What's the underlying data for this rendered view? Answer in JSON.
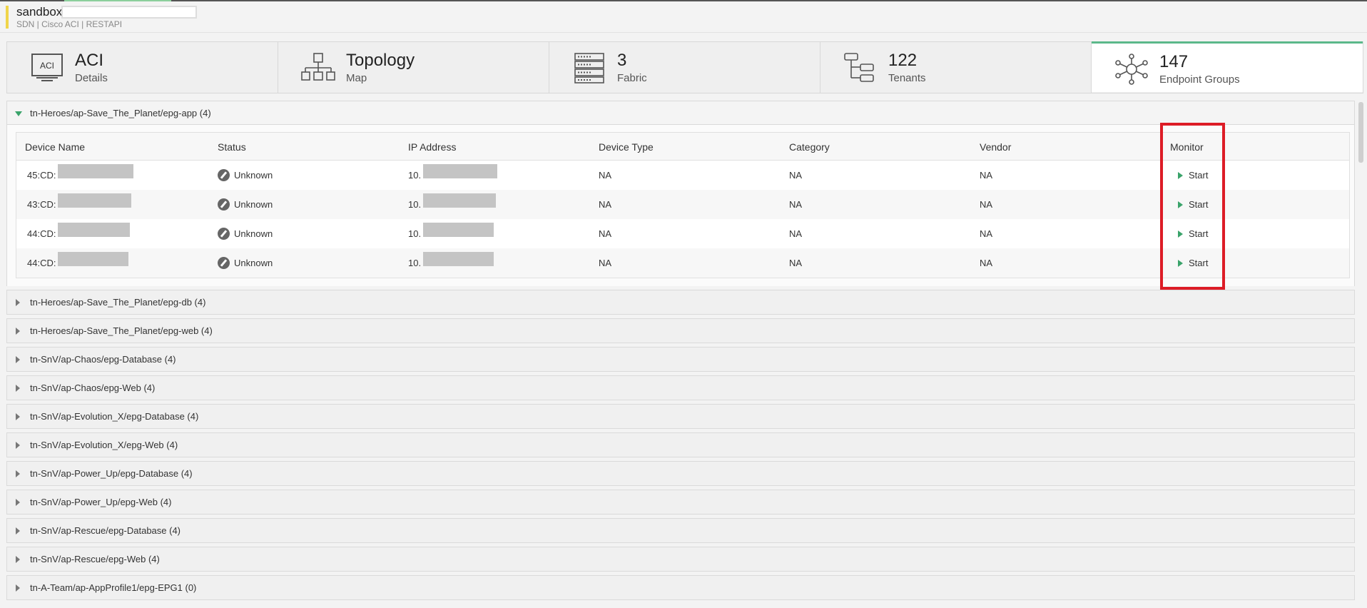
{
  "header": {
    "title": "sandbox",
    "subtitle": "SDN | Cisco ACI | RESTAPI"
  },
  "tiles": [
    {
      "main": "ACI",
      "sub": "Details",
      "icon": "aci-monitor-icon"
    },
    {
      "main": "Topology",
      "sub": "Map",
      "icon": "topology-icon"
    },
    {
      "main": "3",
      "sub": "Fabric",
      "icon": "server-rack-icon"
    },
    {
      "main": "122",
      "sub": "Tenants",
      "icon": "tree-icon"
    },
    {
      "main": "147",
      "sub": "Endpoint Groups",
      "icon": "network-hub-icon"
    }
  ],
  "expanded_group": {
    "label": "tn-Heroes/ap-Save_The_Planet/epg-app (4)",
    "columns": [
      "Device Name",
      "Status",
      "IP Address",
      "Device Type",
      "Category",
      "Vendor",
      "Monitor"
    ],
    "rows": [
      {
        "device": "45:CD:",
        "status": "Unknown",
        "ip": "10.",
        "type": "NA",
        "category": "NA",
        "vendor": "NA",
        "monitor": "Start"
      },
      {
        "device": "43:CD:",
        "status": "Unknown",
        "ip": "10.",
        "type": "NA",
        "category": "NA",
        "vendor": "NA",
        "monitor": "Start"
      },
      {
        "device": "44:CD:",
        "status": "Unknown",
        "ip": "10.",
        "type": "NA",
        "category": "NA",
        "vendor": "NA",
        "monitor": "Start"
      },
      {
        "device": "44:CD:",
        "status": "Unknown",
        "ip": "10.",
        "type": "NA",
        "category": "NA",
        "vendor": "NA",
        "monitor": "Start"
      }
    ]
  },
  "collapsed_groups": [
    "tn-Heroes/ap-Save_The_Planet/epg-db (4)",
    "tn-Heroes/ap-Save_The_Planet/epg-web (4)",
    "tn-SnV/ap-Chaos/epg-Database (4)",
    "tn-SnV/ap-Chaos/epg-Web (4)",
    "tn-SnV/ap-Evolution_X/epg-Database (4)",
    "tn-SnV/ap-Evolution_X/epg-Web (4)",
    "tn-SnV/ap-Power_Up/epg-Database (4)",
    "tn-SnV/ap-Power_Up/epg-Web (4)",
    "tn-SnV/ap-Rescue/epg-Database (4)",
    "tn-SnV/ap-Rescue/epg-Web (4)",
    "tn-A-Team/ap-AppProfile1/epg-EPG1 (0)"
  ],
  "colors": {
    "accent_green": "#3aa36a",
    "active_tile_border": "#5cb88a",
    "highlight_red": "#dd1c26",
    "header_bar_yellow": "#f0d54a"
  }
}
